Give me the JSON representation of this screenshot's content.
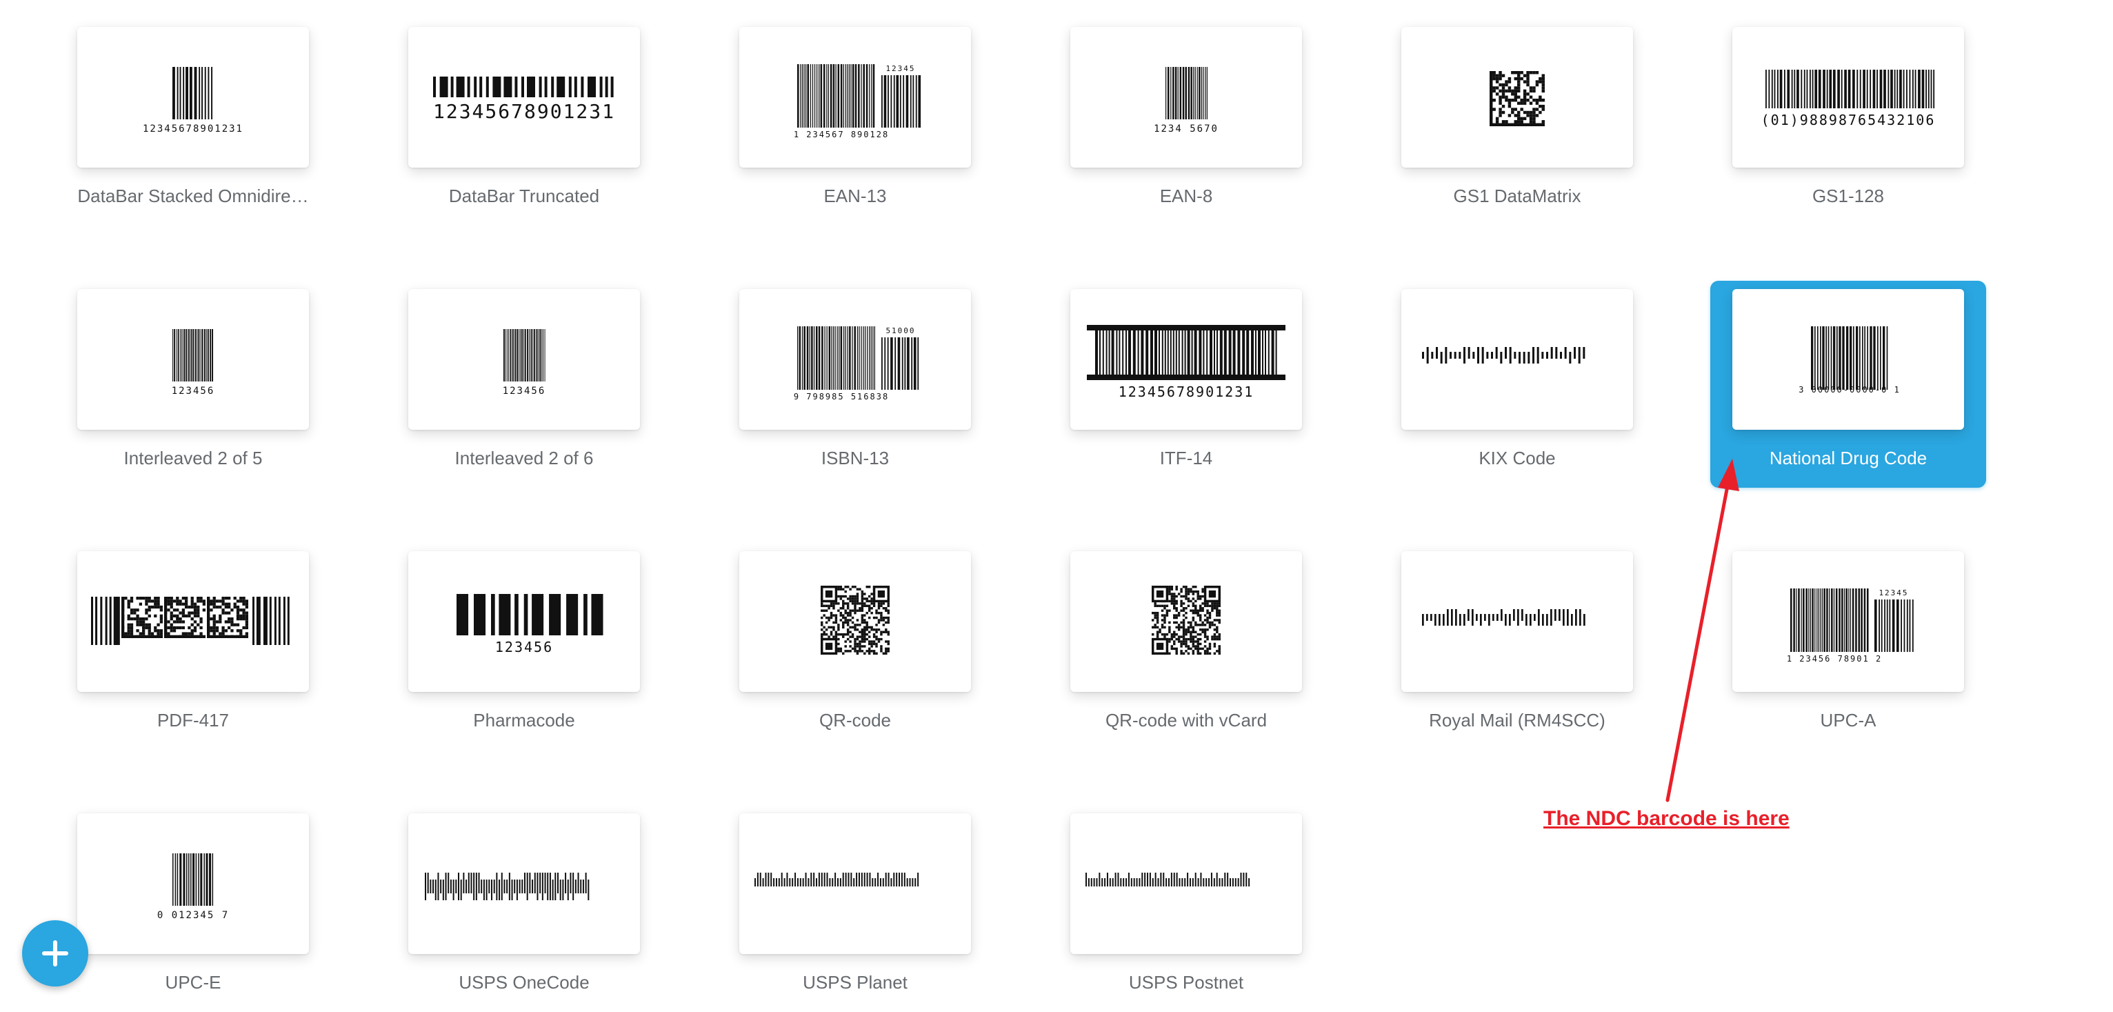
{
  "tiles": [
    {
      "name": "DataBar Stacked Omnidire…",
      "text": "12345678901231",
      "kind": "linear-small",
      "bars": 14,
      "top": "",
      "selected": false
    },
    {
      "name": "DataBar Truncated",
      "text": "12345678901231",
      "kind": "databar",
      "bars": 30,
      "top": "",
      "selected": false
    },
    {
      "name": "EAN-13",
      "text": "1 234567 890128",
      "kind": "ean-addon",
      "bars": 40,
      "top": "12345",
      "selected": false
    },
    {
      "name": "EAN-8",
      "text": "1234 5670",
      "kind": "linear-small",
      "bars": 22,
      "top": "",
      "selected": false
    },
    {
      "name": "GS1 DataMatrix",
      "text": "",
      "kind": "datamatrix",
      "bars": 0,
      "top": "",
      "selected": false
    },
    {
      "name": "GS1-128",
      "text": "(01)98898765432106",
      "kind": "linear-wide",
      "bars": 60,
      "top": "",
      "selected": false
    },
    {
      "name": "Interleaved 2 of 5",
      "text": "123456",
      "kind": "linear-small",
      "bars": 28,
      "top": "",
      "selected": false
    },
    {
      "name": "Interleaved 2 of 6",
      "text": "123456",
      "kind": "linear-small",
      "bars": 28,
      "top": "",
      "selected": false
    },
    {
      "name": "ISBN-13",
      "text": "9 798985 516838",
      "kind": "ean-addon",
      "bars": 40,
      "top": "51000",
      "selected": false
    },
    {
      "name": "ITF-14",
      "text": "12345678901231",
      "kind": "itf",
      "bars": 60,
      "top": "",
      "selected": false
    },
    {
      "name": "KIX Code",
      "text": "",
      "kind": "postal",
      "bars": 36,
      "top": "",
      "selected": false
    },
    {
      "name": "National Drug Code",
      "text": "3 00000-0000-0 1",
      "kind": "ndc",
      "bars": 30,
      "top": "",
      "selected": true
    },
    {
      "name": "PDF-417",
      "text": "",
      "kind": "pdf417",
      "bars": 0,
      "top": "",
      "selected": false
    },
    {
      "name": "Pharmacode",
      "text": "123456",
      "kind": "pharmacode",
      "bars": 16,
      "top": "",
      "selected": false
    },
    {
      "name": "QR-code",
      "text": "",
      "kind": "qr",
      "bars": 0,
      "top": "",
      "selected": false
    },
    {
      "name": "QR-code with vCard",
      "text": "",
      "kind": "qr",
      "bars": 0,
      "top": "",
      "selected": false
    },
    {
      "name": "Royal Mail (RM4SCC)",
      "text": "",
      "kind": "postal",
      "bars": 40,
      "top": "",
      "selected": false
    },
    {
      "name": "UPC-A",
      "text": "1 23456 78901 2",
      "kind": "ean-addon",
      "bars": 40,
      "top": "12345",
      "selected": false
    },
    {
      "name": "UPC-E",
      "text": "0 012345 7",
      "kind": "linear-small",
      "bars": 18,
      "top": "",
      "selected": false
    },
    {
      "name": "USPS OneCode",
      "text": "",
      "kind": "onecode",
      "bars": 65,
      "top": "",
      "selected": false
    },
    {
      "name": "USPS Planet",
      "text": "",
      "kind": "planet",
      "bars": 62,
      "top": "",
      "selected": false
    },
    {
      "name": "USPS Postnet",
      "text": "",
      "kind": "postnet",
      "bars": 62,
      "top": "",
      "selected": false
    }
  ],
  "fab": {
    "label": "+"
  },
  "annotation": {
    "text": "The NDC barcode is here",
    "color": "#e8202a"
  },
  "colors": {
    "accent": "#2aa6e0",
    "label": "#666a6e"
  }
}
